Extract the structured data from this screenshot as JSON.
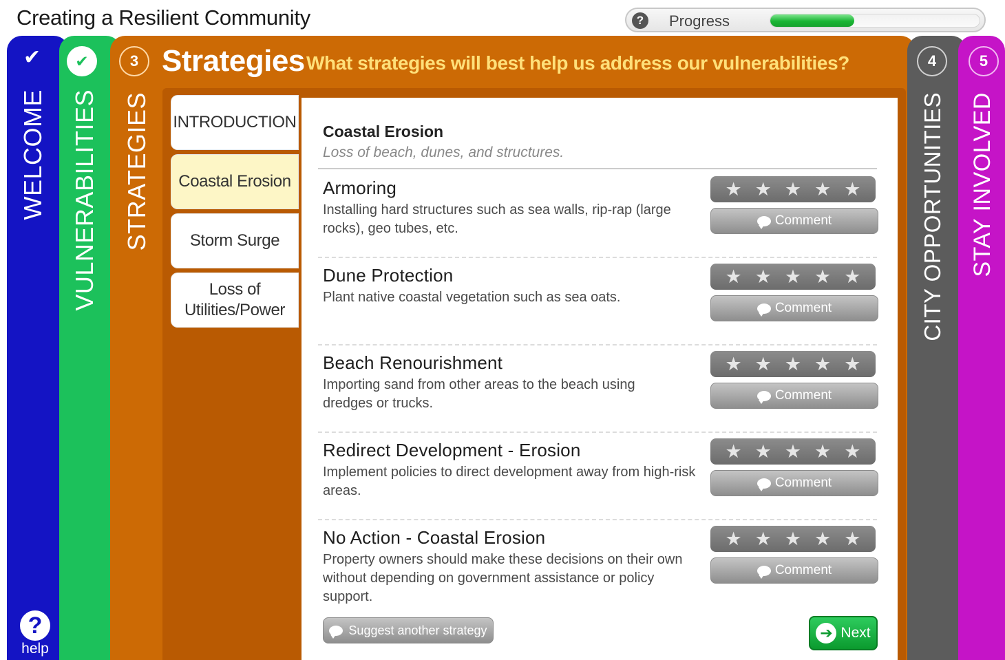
{
  "app": {
    "title": "Creating a Resilient Community"
  },
  "progress": {
    "help_glyph": "?",
    "label": "Progress",
    "value": 0.4
  },
  "tabs": [
    {
      "label": "WELCOME",
      "badge": "✔",
      "color": "#1414c4"
    },
    {
      "label": "VULNERABILITIES",
      "badge": "✔",
      "color": "#1cc15b"
    },
    {
      "label": "STRATEGIES",
      "badge": "3",
      "color": "#cc6a05"
    },
    {
      "label": "CITY OPPORTUNITIES",
      "badge": "4",
      "color": "#5c5c5c"
    },
    {
      "label": "STAY INVOLVED",
      "badge": "5",
      "color": "#c514c7"
    }
  ],
  "strategies": {
    "heading": "Strategies",
    "question": "What strategies will best help us address our vulnerabilities?"
  },
  "subnav": [
    {
      "label": "INTRODUCTION"
    },
    {
      "label": "Coastal Erosion"
    },
    {
      "label": "Storm Surge"
    },
    {
      "label": "Loss of Utilities/Power"
    }
  ],
  "content": {
    "title": "Coastal Erosion",
    "subtitle": "Loss of beach, dunes, and structures.",
    "items": [
      {
        "name": "Armoring",
        "description": "Installing hard structures such as sea walls, rip-rap (large rocks), geo tubes, etc.",
        "comment_label": "Comment"
      },
      {
        "name": "Dune Protection",
        "description": "Plant native coastal vegetation such as sea oats.",
        "comment_label": "Comment"
      },
      {
        "name": "Beach Renourishment",
        "description": "Importing sand from other areas to the beach using dredges or trucks.",
        "comment_label": "Comment"
      },
      {
        "name": "Redirect Development - Erosion",
        "description": "Implement policies to direct development away from high-risk areas.",
        "comment_label": "Comment"
      },
      {
        "name": "No Action - Coastal Erosion",
        "description": "Property owners should make these decisions on their own without depending on government assistance or policy support.",
        "comment_label": "Comment"
      }
    ],
    "suggest_label": "Suggest another strategy",
    "next_label": "Next"
  },
  "help": {
    "glyph": "?",
    "label": "help"
  },
  "colors": {
    "accent_question": "#ffe07a",
    "next_green": "#0b9a2e"
  }
}
